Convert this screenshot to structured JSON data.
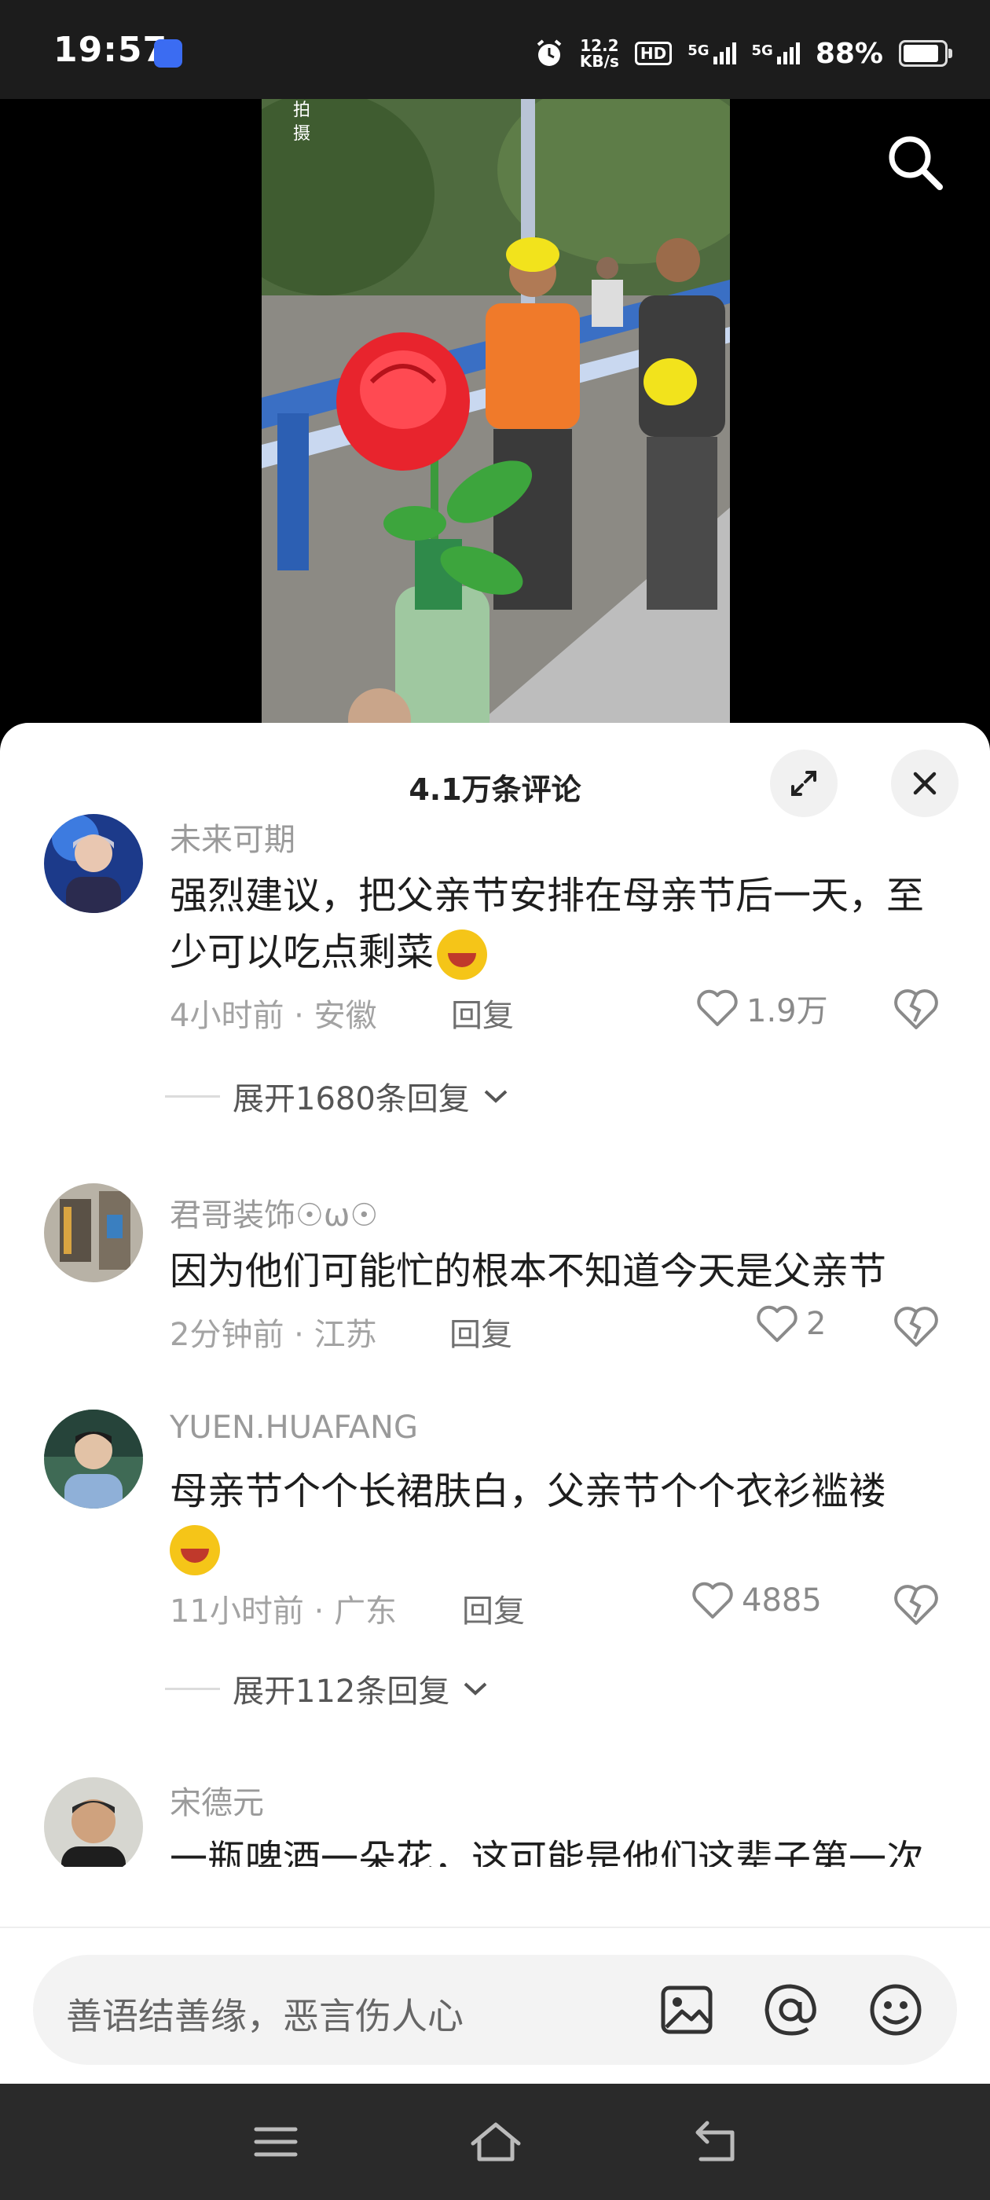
{
  "status_bar": {
    "time": "19:57",
    "net_speed_value": "12.2",
    "net_speed_unit": "KB/s",
    "hd_label": "HD",
    "signal_1": "5G",
    "signal_2": "5G",
    "battery": "88%"
  },
  "video": {
    "watermark_line1": "拍",
    "watermark_line2": "摄"
  },
  "comments_panel": {
    "title": "4.1万条评论",
    "comments": [
      {
        "user": "未来可期",
        "text": "强烈建议，把父亲节安排在母亲节后一天，至少可以吃点剩菜",
        "time": "4小时前",
        "location": "安徽",
        "reply_label": "回复",
        "likes": "1.9万",
        "expand": "展开1680条回复"
      },
      {
        "user": "君哥装饰☉ω☉",
        "text": "因为他们可能忙的根本不知道今天是父亲节",
        "time": "2分钟前",
        "location": "江苏",
        "reply_label": "回复",
        "likes": "2"
      },
      {
        "user": "YUEN.HUAFANG",
        "text": "母亲节个个长裙肤白，父亲节个个衣衫褴褛",
        "time": "11小时前",
        "location": "广东",
        "reply_label": "回复",
        "likes": "4885",
        "expand": "展开112条回复"
      },
      {
        "user": "宋德元",
        "text": "一瓶啤酒一朵花，这可能是他们这辈子第一次收到最浪漫最实惠的礼物"
      }
    ],
    "meta_separator": "·"
  },
  "input": {
    "placeholder": "善语结善缘，恶言伤人心"
  },
  "colors": {
    "accent_heart": "#8a8a8a",
    "sheet_bg": "#ffffff",
    "nav_bg": "#2a2a2a"
  }
}
